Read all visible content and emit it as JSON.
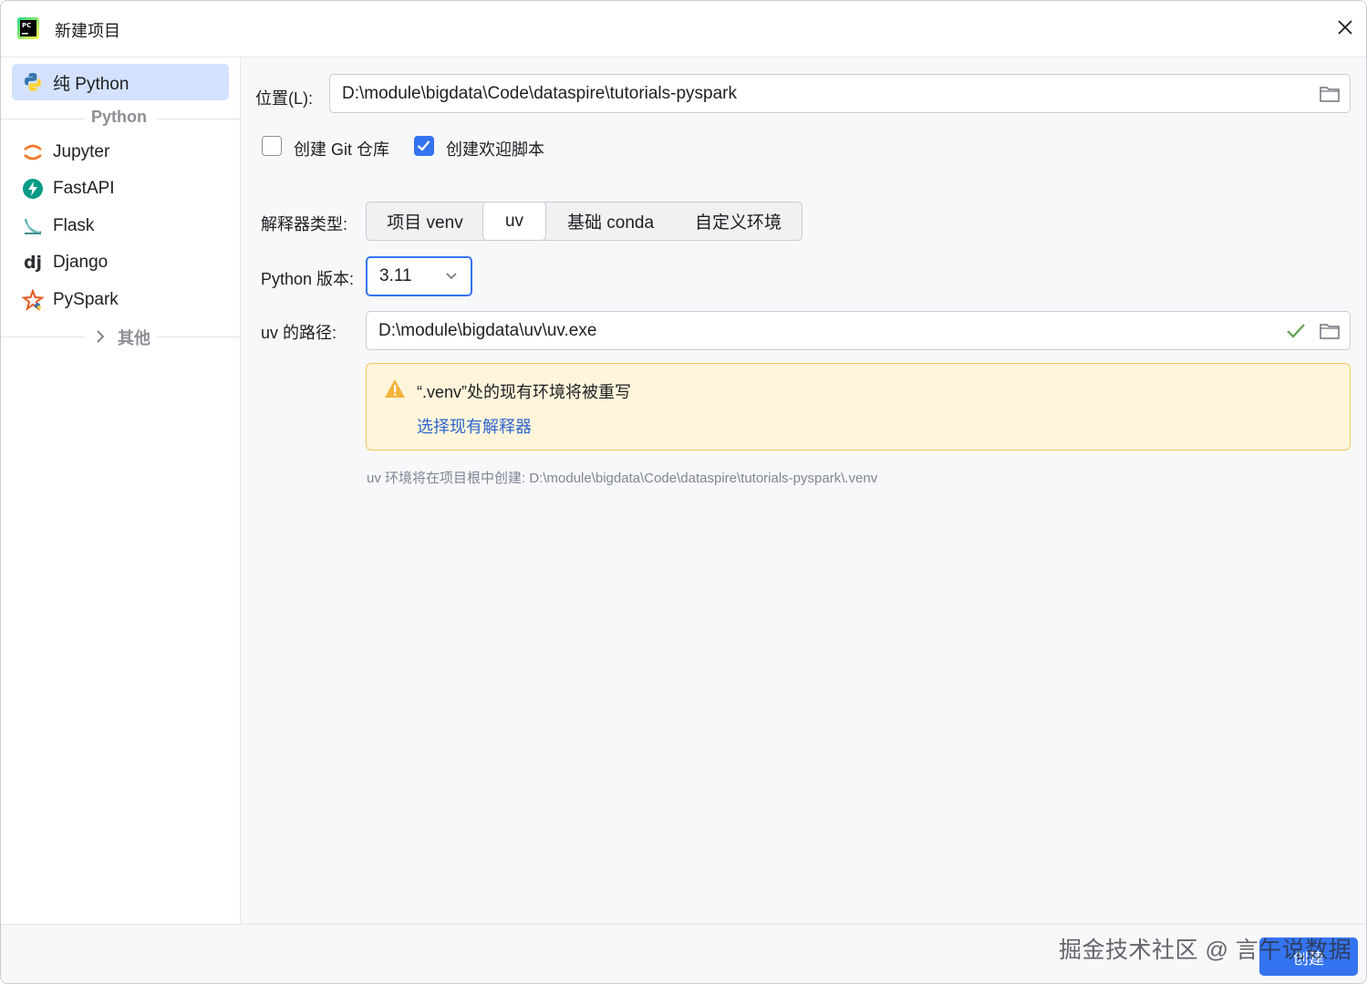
{
  "window": {
    "title": "新建项目",
    "icon": "pycharm-icon"
  },
  "sidebar": {
    "items": [
      {
        "label": "纯 Python",
        "icon": "python-icon",
        "selected": true
      }
    ],
    "group_python": "Python",
    "group_items": [
      {
        "label": "Jupyter",
        "icon": "jupyter-icon"
      },
      {
        "label": "FastAPI",
        "icon": "fastapi-icon"
      },
      {
        "label": "Flask",
        "icon": "flask-icon"
      },
      {
        "label": "Django",
        "icon": "django-icon"
      },
      {
        "label": "PySpark",
        "icon": "pyspark-icon"
      }
    ],
    "group_other": "其他"
  },
  "form": {
    "location_label": "位置(L):",
    "location_value": "D:\\module\\bigdata\\Code\\dataspire\\tutorials-pyspark",
    "git_checkbox_label": "创建 Git 仓库",
    "git_checked": false,
    "welcome_checkbox_label": "创建欢迎脚本",
    "welcome_checked": true,
    "interpreter_type_label": "解释器类型:",
    "interpreter_types": [
      "项目 venv",
      "uv",
      "基础 conda",
      "自定义环境"
    ],
    "interpreter_selected": "uv",
    "python_version_label": "Python 版本:",
    "python_version_value": "3.11",
    "uv_path_label": "uv 的路径:",
    "uv_path_value": "D:\\module\\bigdata\\uv\\uv.exe",
    "warning_text": "“.venv”处的现有环境将被重写",
    "warning_link": "选择现有解释器",
    "hint": "uv 环境将在项目根中创建: D:\\module\\bigdata\\Code\\dataspire\\tutorials-pyspark\\.venv"
  },
  "footer": {
    "create_label": "创建",
    "watermark": "掘金技术社区 @ 言午说数据"
  },
  "colors": {
    "accent": "#3574f0",
    "selected_bg": "#d4e2ff",
    "warning_bg": "#fff5db",
    "warning_border": "#f2c55c",
    "ok_green": "#5fa04e"
  }
}
